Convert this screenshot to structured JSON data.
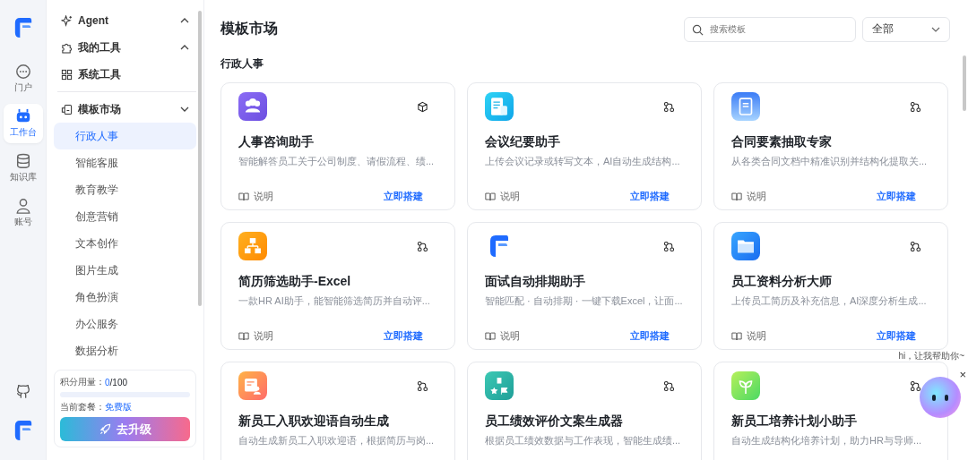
{
  "rail": [
    {
      "label": "门户",
      "selected": false
    },
    {
      "label": "工作台",
      "selected": true
    },
    {
      "label": "知识库",
      "selected": false
    },
    {
      "label": "账号",
      "selected": false
    }
  ],
  "sidebar": {
    "groups": [
      {
        "label": "Agent",
        "expanded": false
      },
      {
        "label": "我的工具",
        "expanded": false
      },
      {
        "label": "系统工具"
      },
      {
        "label": "模板市场",
        "expanded": true,
        "children": [
          {
            "label": "行政人事",
            "selected": true
          },
          {
            "label": "智能客服",
            "selected": false
          },
          {
            "label": "教育教学",
            "selected": false
          },
          {
            "label": "创意营销",
            "selected": false
          },
          {
            "label": "文本创作",
            "selected": false
          },
          {
            "label": "图片生成",
            "selected": false
          },
          {
            "label": "角色扮演",
            "selected": false
          },
          {
            "label": "办公服务",
            "selected": false
          },
          {
            "label": "数据分析",
            "selected": false
          }
        ]
      }
    ],
    "quota": {
      "label": "积分用量：",
      "used": "0",
      "limit": "/100",
      "level": 0
    },
    "plan": {
      "label": "当前套餐：",
      "value": "免费版"
    },
    "upgrade": "去升级"
  },
  "main": {
    "title": "模板市场",
    "search": {
      "placeholder": "搜索模板"
    },
    "filter": "全部",
    "section": "行政人事",
    "cards": [
      {
        "kind": "agent",
        "title": "人事咨询助手",
        "desc": "智能解答员工关于公司制度、请假流程、绩...",
        "doc": "说明",
        "action": "立即搭建"
      },
      {
        "kind": "workflow",
        "title": "会议纪要助手",
        "desc": "上传会议记录或转写文本，AI自动生成结构...",
        "doc": "说明",
        "action": "立即搭建"
      },
      {
        "kind": "workflow",
        "title": "合同要素抽取专家",
        "desc": "从各类合同文档中精准识别并结构化提取关...",
        "doc": "说明",
        "action": "立即搭建"
      },
      {
        "kind": "workflow",
        "title": "简历筛选助手-Excel",
        "desc": "一款HR AI助手，能智能筛选简历并自动评...",
        "doc": "说明",
        "action": "立即搭建"
      },
      {
        "kind": "workflow",
        "title": "面试自动排期助手",
        "desc": "智能匹配 · 自动排期 · 一键下载Excel，让面...",
        "doc": "说明",
        "action": "立即搭建"
      },
      {
        "kind": "workflow",
        "title": "员工资料分析大师",
        "desc": "上传员工简历及补充信息，AI深度分析生成...",
        "doc": "说明",
        "action": "立即搭建"
      },
      {
        "kind": "workflow",
        "title": "新员工入职欢迎语自动生成",
        "desc": "自动生成新员工入职欢迎语，根据简历与岗..."
      },
      {
        "kind": "workflow",
        "title": "员工绩效评价文案生成器",
        "desc": "根据员工绩效数据与工作表现，智能生成绩..."
      },
      {
        "kind": "workflow",
        "title": "新员工培养计划小助手",
        "desc": "自动生成结构化培养计划，助力HR与导师..."
      }
    ]
  },
  "assistant": {
    "greeting": "hi，让我帮助你~",
    "close": "×"
  }
}
